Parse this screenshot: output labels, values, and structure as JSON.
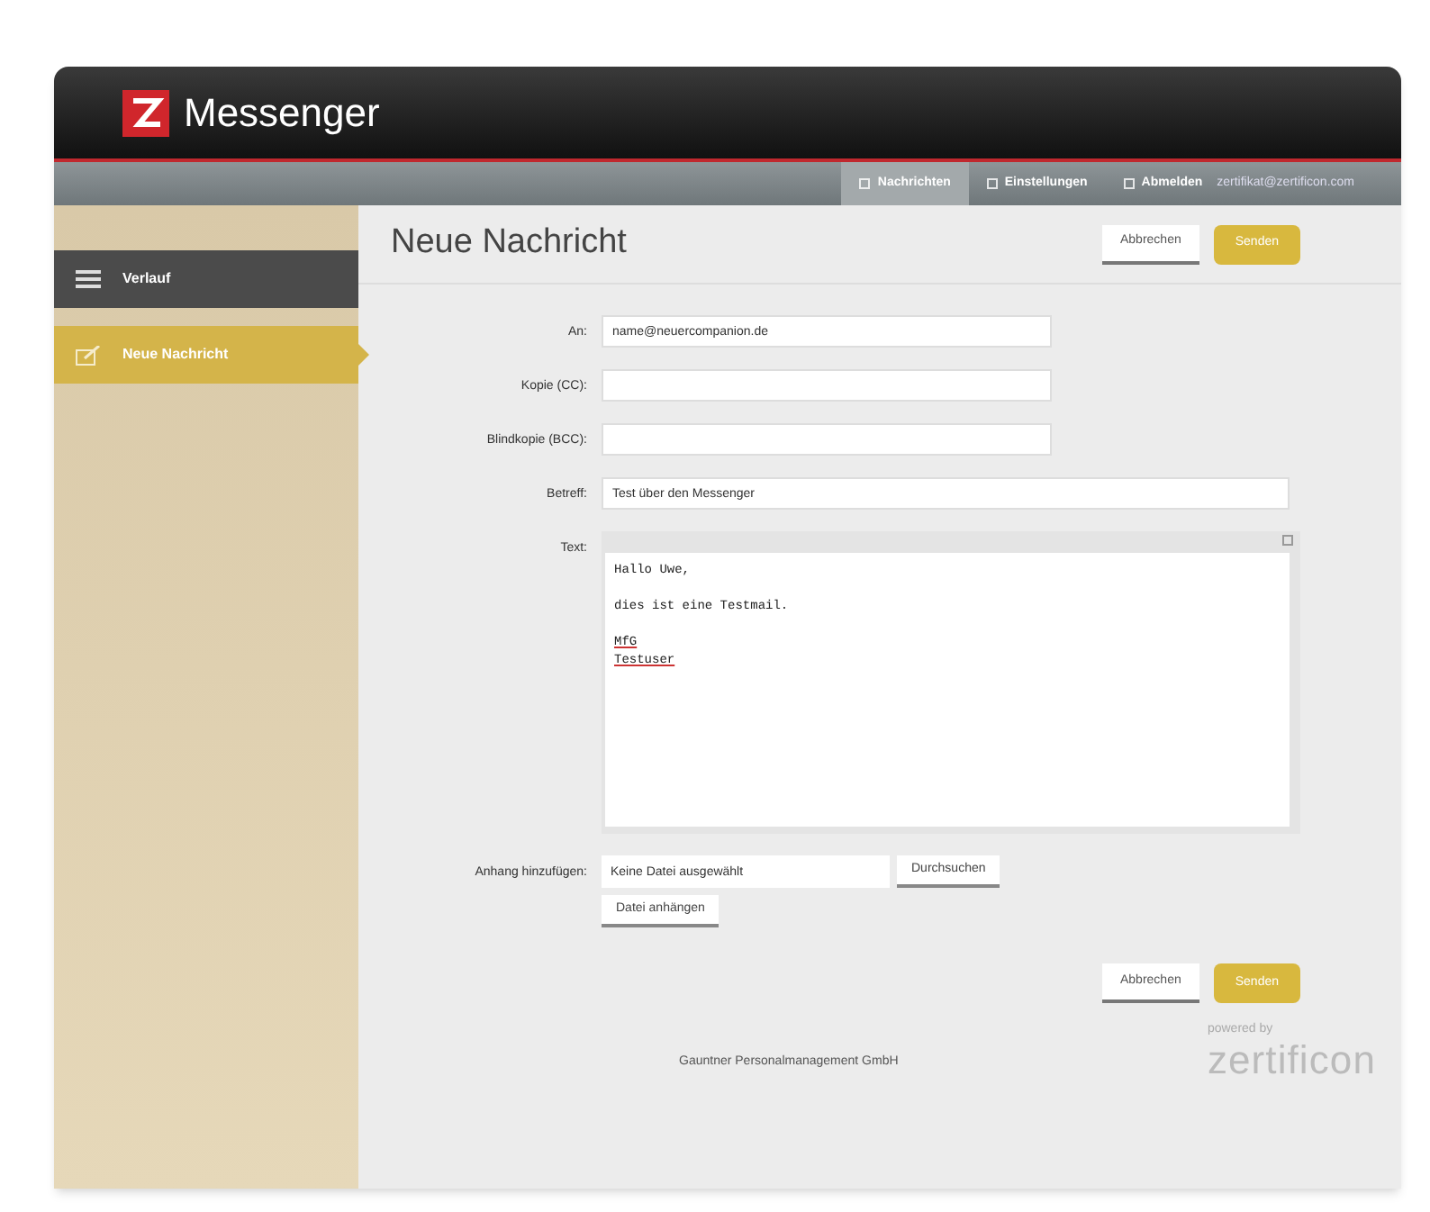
{
  "app": {
    "title": "Messenger"
  },
  "nav": [
    {
      "label": "Nachrichten",
      "selected": true
    },
    {
      "label": "Einstellungen",
      "selected": false
    },
    {
      "label": "Abmelden",
      "selected": false,
      "user": "zertifikat@zertificon.com"
    }
  ],
  "sidebar": {
    "items": [
      {
        "label": "Verlauf",
        "kind": "history",
        "selected": false
      },
      {
        "label": "Neue Nachricht",
        "kind": "compose",
        "selected": true
      }
    ]
  },
  "page": {
    "title": "Neue Nachricht",
    "buttons": [
      "Abbrechen",
      "Senden"
    ]
  },
  "form": {
    "fields": [
      {
        "label": "An:",
        "value": "name@neuercompanion.de",
        "wide": false
      },
      {
        "label": "Kopie (CC):",
        "wide": false
      },
      {
        "label": "Blindkopie (BCC):",
        "wide": false
      },
      {
        "label": "Betreff:",
        "value": "Test über den Messenger",
        "wide": true
      }
    ],
    "text_label": "Text:",
    "text_lines": [
      {
        "kind": "text",
        "text": "Hallo Uwe,",
        "misspelled": false
      },
      {
        "kind": "blank"
      },
      {
        "kind": "text",
        "text": "dies ist eine Testmail.",
        "misspelled": false
      },
      {
        "kind": "blank"
      },
      {
        "kind": "text",
        "text": "MfG",
        "misspelled": true
      },
      {
        "kind": "text",
        "text": "Testuser",
        "misspelled": true
      }
    ],
    "attachment": {
      "label": "Anhang hinzufügen:",
      "value": "Keine Datei ausgewählt",
      "browse": "Durchsuchen",
      "attach": "Datei anhängen"
    }
  },
  "bottom_buttons": [
    "Abbrechen",
    "Senden"
  ],
  "footer": {
    "text": "Gauntner Personalmanagement GmbH",
    "powered": "powered by",
    "brand": "zertificon"
  }
}
